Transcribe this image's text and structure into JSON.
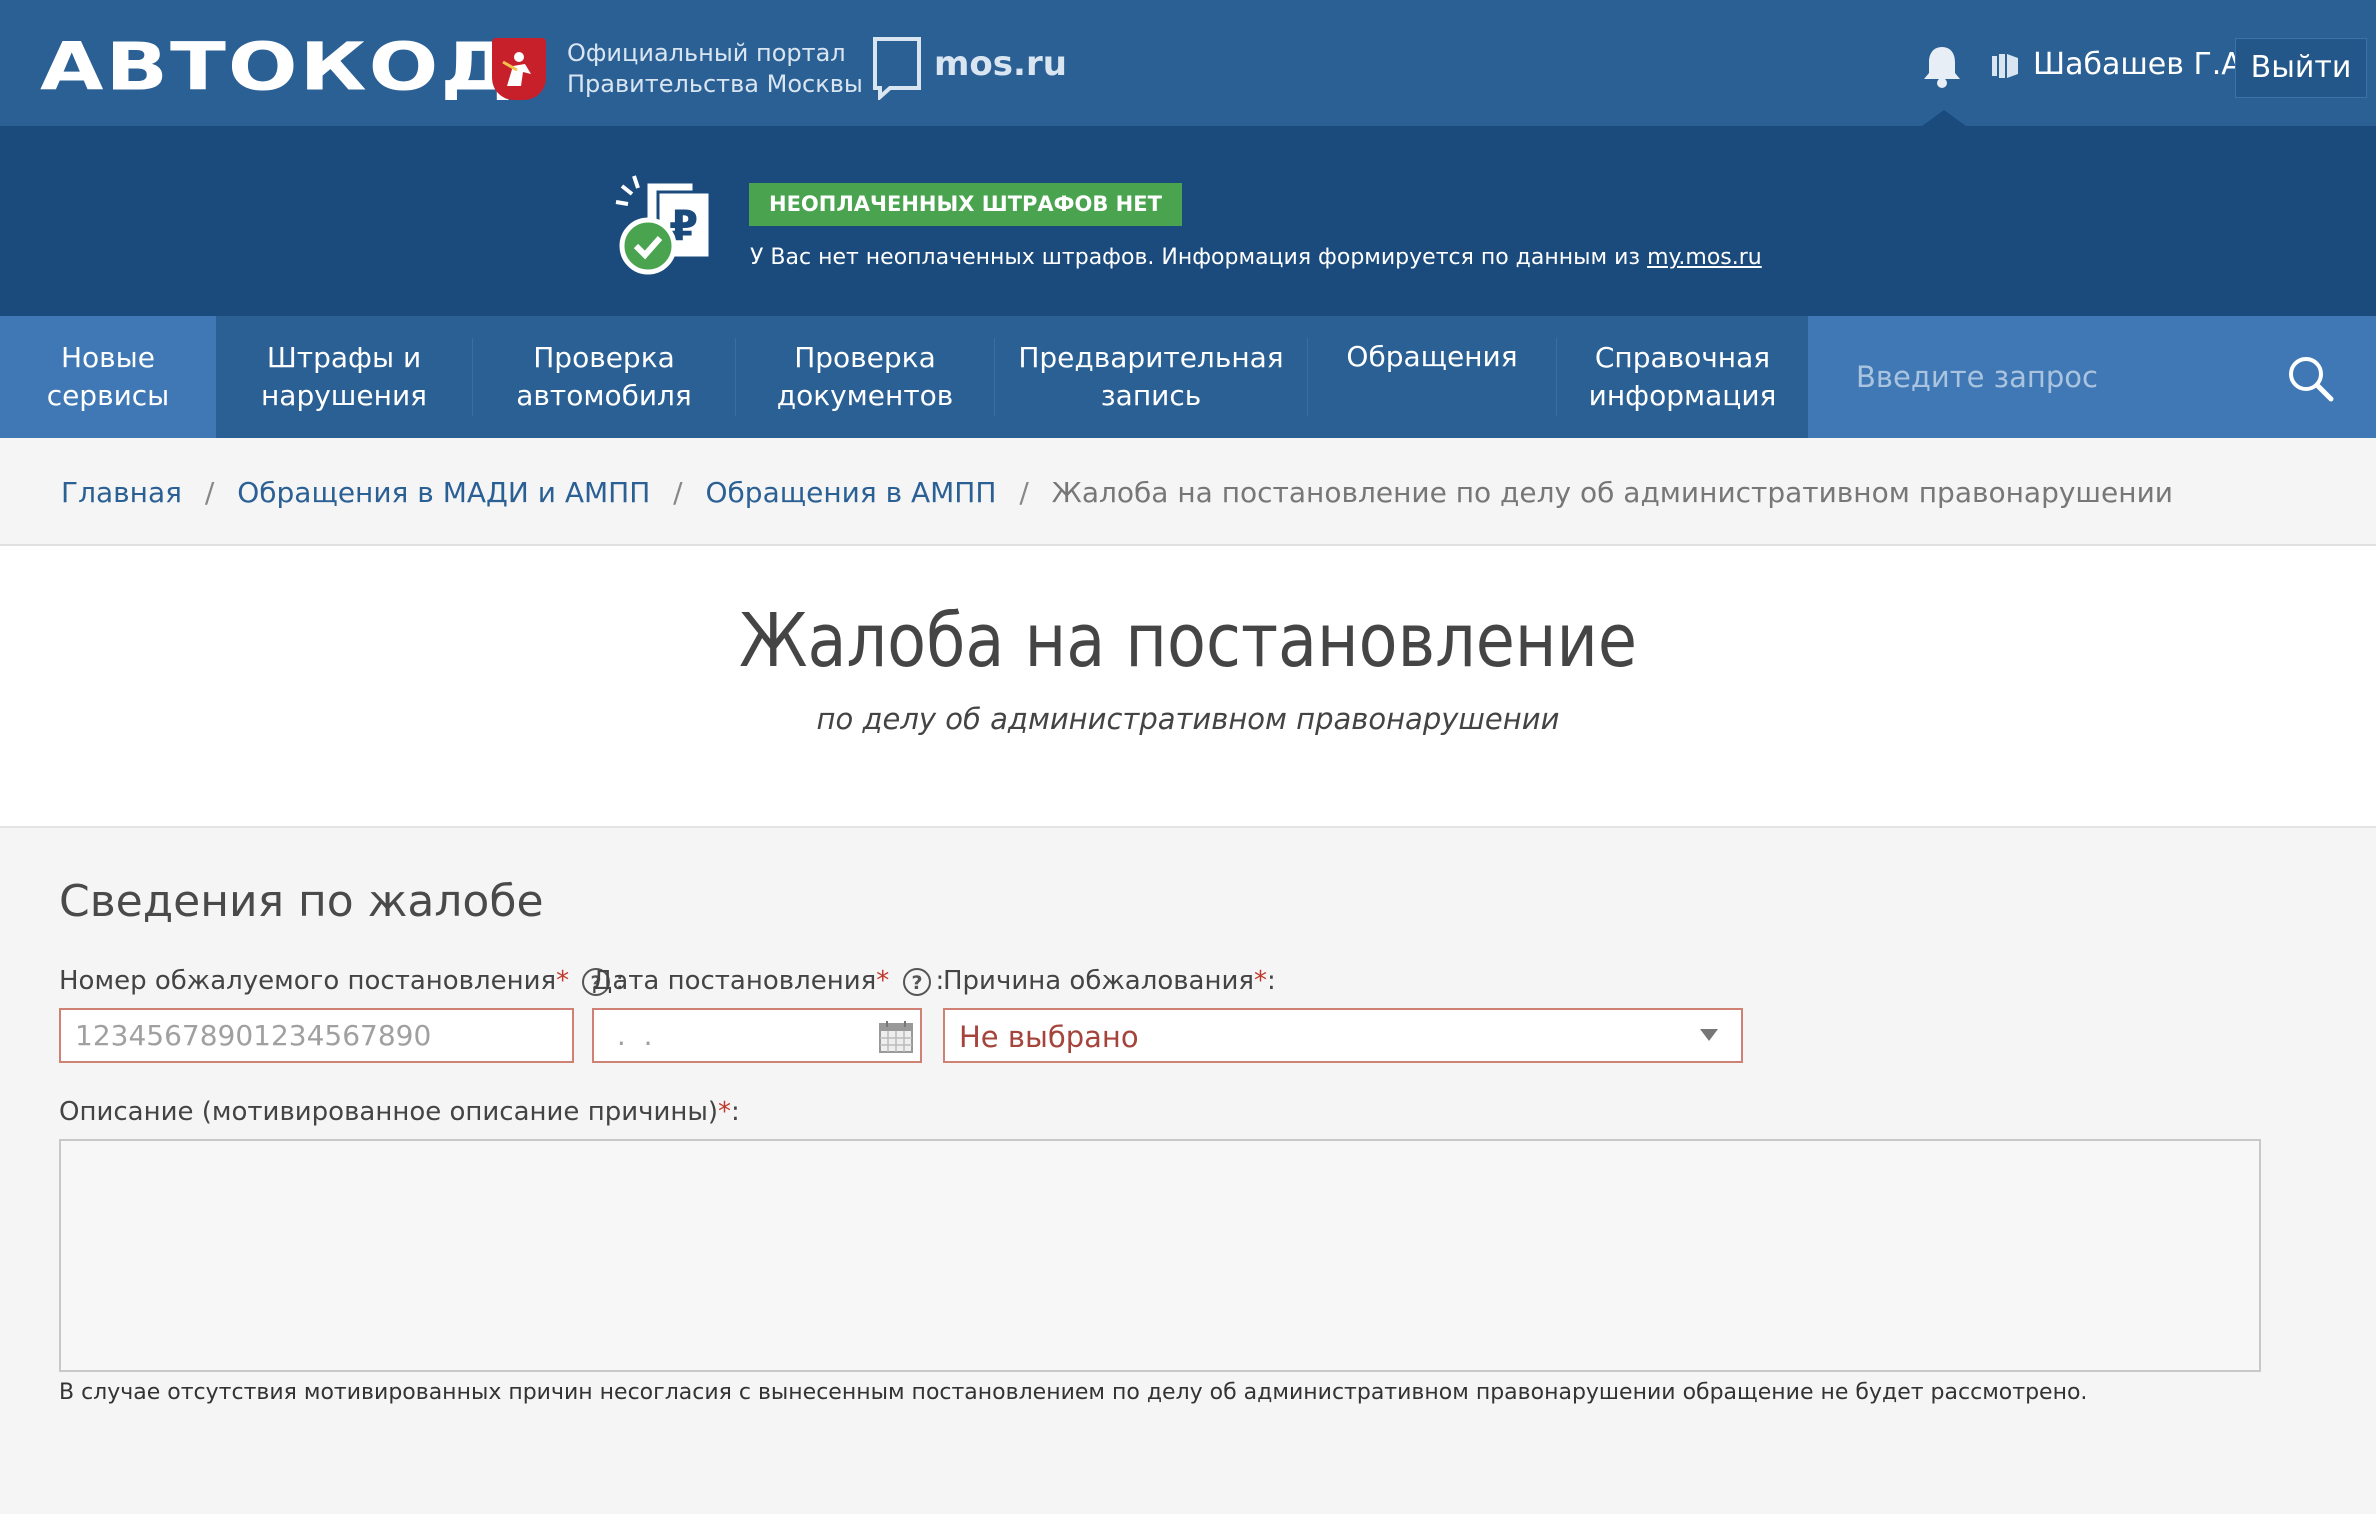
{
  "header": {
    "logo_text": "АВТОКОД",
    "portal_line1": "Официальный портал",
    "portal_line2": "Правительства Москвы",
    "mos_label": "mos.ru",
    "user_name": "Шабашев Г.А.",
    "logout_label": "Выйти"
  },
  "fines": {
    "badge": "НЕОПЛАЧЕННЫХ ШТРАФОВ НЕТ",
    "text": "У Вас нет неоплаченных штрафов. Информация формируется по данным из ",
    "link": "my.mos.ru"
  },
  "nav": {
    "items": [
      {
        "line1": "Новые",
        "line2": "сервисы"
      },
      {
        "line1": "Штрафы и",
        "line2": "нарушения"
      },
      {
        "line1": "Проверка",
        "line2": "автомобиля"
      },
      {
        "line1": "Проверка",
        "line2": "документов"
      },
      {
        "line1": "Предварительная",
        "line2": "запись"
      },
      {
        "line1": "Обращения",
        "line2": ""
      },
      {
        "line1": "Справочная",
        "line2": "информация"
      }
    ],
    "search_placeholder": "Введите запрос"
  },
  "breadcrumb": {
    "items": [
      "Главная",
      "Обращения в МАДИ и АМПП",
      "Обращения в АМПП"
    ],
    "current": "Жалоба на постановление по делу об административном правонарушении",
    "separator": "/"
  },
  "page": {
    "title": "Жалоба на постановление",
    "subtitle": "по делу об административном правонарушении"
  },
  "form": {
    "section_title": "Сведения по жалобе",
    "required_mark": "*",
    "number": {
      "label": "Номер обжалуемого постановления",
      "suffix": ":",
      "placeholder": "12345678901234567890"
    },
    "date": {
      "label": "Дата постановления",
      "suffix": ":",
      "placeholder": " .  ."
    },
    "reason": {
      "label": "Причина обжалования",
      "suffix": ":",
      "value": "Не выбрано"
    },
    "description": {
      "label": "Описание (мотивированное описание причины)",
      "suffix": ":"
    },
    "note": "В случае отсутствия мотивированных причин несогласия с вынесенным постановлением по делу об административном правонарушении обращение не будет рассмотрено."
  },
  "colors": {
    "header_blue": "#2b6095",
    "banner_blue": "#1b4b7d",
    "nav_active": "#3f78b4",
    "badge_green": "#4aa34f",
    "field_border": "#cf8273",
    "required_red": "#c0392b"
  }
}
